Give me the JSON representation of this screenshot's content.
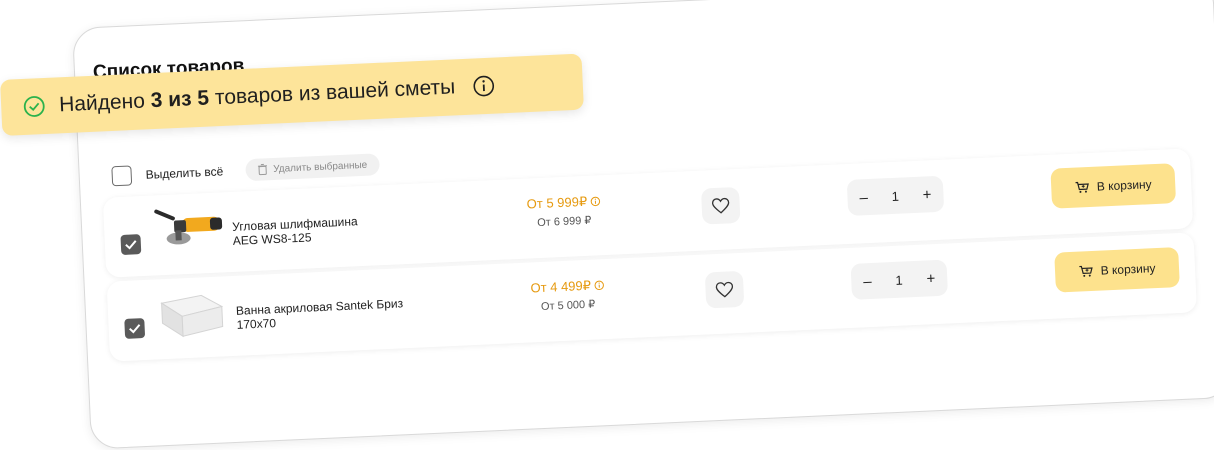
{
  "list": {
    "title": "Список товаров",
    "select_all_label": "Выделить всё",
    "delete_selected_label": "Удалить выбранные"
  },
  "banner": {
    "prefix": "Найдено",
    "found_count": "3 из 5",
    "suffix": "товаров из вашей сметы"
  },
  "products": [
    {
      "name_line1": "Угловая шлифмашина",
      "name_line2": "AEG WS8-125",
      "price_now": "От 5 999₽",
      "price_old": "От 6 999 ₽",
      "quantity": "1",
      "checked": true,
      "cart_label": "В корзину"
    },
    {
      "name_line1": "Ванна акриловая Santek Бриз",
      "name_line2": "170x70",
      "price_now": "От 4 499₽",
      "price_old": "От 5 000 ₽",
      "quantity": "1",
      "checked": true,
      "cart_label": "В корзину"
    }
  ],
  "qty_controls": {
    "minus": "–",
    "plus": "+"
  },
  "colors": {
    "accent_yellow": "#fde28d",
    "banner_yellow": "#fde49a",
    "price_orange": "#e69a10",
    "success_green": "#2bb24c"
  }
}
